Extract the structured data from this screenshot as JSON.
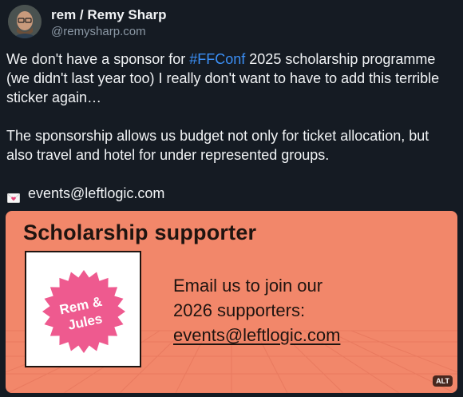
{
  "author": {
    "display_name": "rem / Remy Sharp",
    "handle": "@remysharp.com"
  },
  "post": {
    "line1_before": "We don't have a sponsor for ",
    "hashtag": "#FFConf",
    "line1_after": " 2025 scholarship programme (we didn't last year too) I really don't want to have to add this terrible sticker again…",
    "paragraph2": "The sponsorship allows us budget not only for ticket allocation, but also travel and hotel for under represented groups.",
    "email_icon": "love-letter-icon",
    "email": "events@leftlogic.com"
  },
  "media": {
    "title": "Scholarship supporter",
    "badge_line1": "Rem &",
    "badge_line2": "Jules",
    "copy_line1": "Email us to join our",
    "copy_line2": "2026 supporters:",
    "copy_email": "events@leftlogic.com",
    "alt_label": "ALT"
  },
  "colors": {
    "background": "#151b23",
    "hashtag": "#3b8ff5",
    "sticker_bg": "#f2876a",
    "badge_pink": "#ee5a8f"
  }
}
